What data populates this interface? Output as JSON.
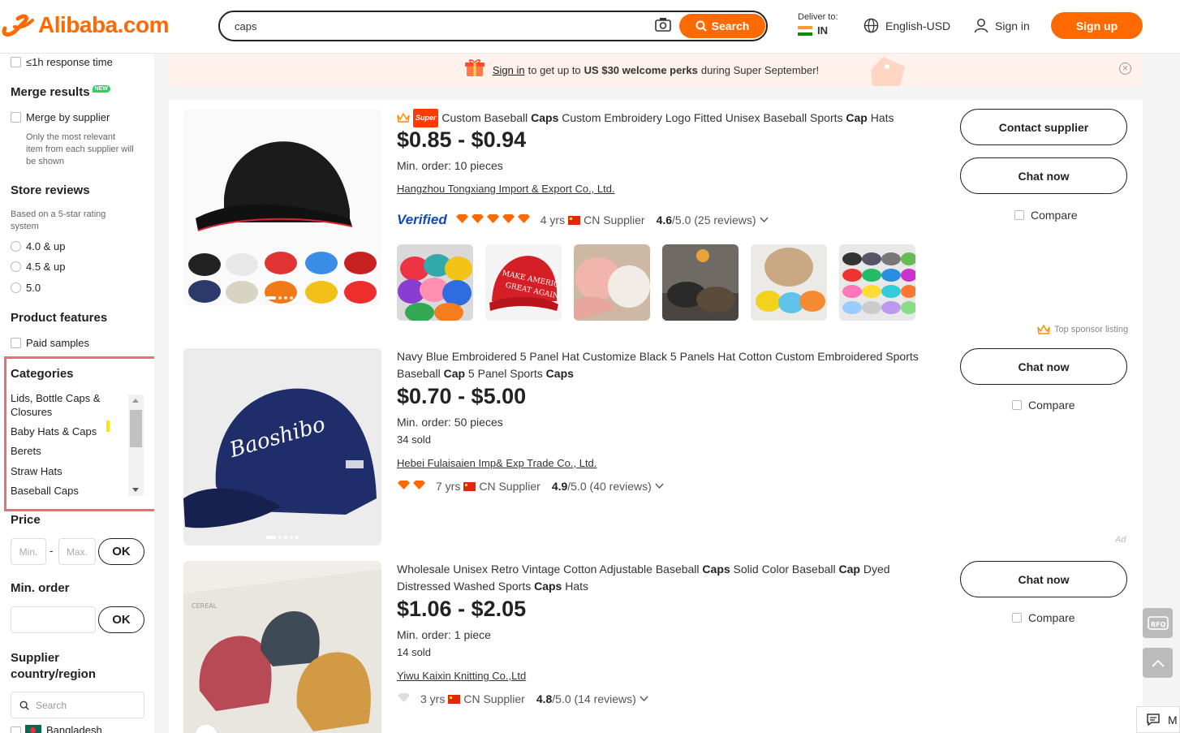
{
  "header": {
    "logo_text": "Alibaba.com",
    "search_value": "caps",
    "search_button": "Search",
    "deliver_label": "Deliver to:",
    "deliver_country": "IN",
    "language": "English-USD",
    "sign_in": "Sign in",
    "sign_up": "Sign up"
  },
  "sidebar": {
    "response_time": "≤1h response time",
    "merge_title": "Merge results",
    "merge_badge": "NEW",
    "merge_option": "Merge by supplier",
    "merge_note_1": "Only the most relevant",
    "merge_note_2": "item from each supplier will",
    "merge_note_3": "be shown",
    "store_reviews_title": "Store reviews",
    "store_reviews_note_1": "Based on a 5-star rating",
    "store_reviews_note_2": "system",
    "ratings": [
      "4.0 & up",
      "4.5 & up",
      "5.0"
    ],
    "features_title": "Product features",
    "paid_samples": "Paid samples",
    "categories_title": "Categories",
    "categories": [
      "Lids, Bottle Caps & Closures",
      "Baby Hats & Caps",
      "Berets",
      "Straw Hats",
      "Baseball Caps"
    ],
    "price_title": "Price",
    "price_min_placeholder": "Min.",
    "price_max_placeholder": "Max.",
    "price_dash": "-",
    "ok": "OK",
    "min_order_title": "Min. order",
    "supplier_country_title_1": "Supplier",
    "supplier_country_title_2": "country/region",
    "country_search_placeholder": "Search",
    "country_first": "Bangladesh"
  },
  "banner": {
    "sign_in_link": "Sign in",
    "text_1": "to get up to",
    "highlight": "US $30 welcome perks",
    "text_2": "during Super September!"
  },
  "products": [
    {
      "badge": "Super",
      "title_parts": [
        {
          "t": "Custom Baseball ",
          "b": false
        },
        {
          "t": "Caps",
          "b": true
        },
        {
          "t": " Custom Embroidery Logo Fitted Unisex Baseball Sports ",
          "b": false
        },
        {
          "t": "Cap",
          "b": true
        },
        {
          "t": " Hats",
          "b": false
        }
      ],
      "price": "$0.85 - $0.94",
      "min_order": "Min. order: 10 pieces",
      "supplier": "Hangzhou Tongxiang Import & Export Co., Ltd.",
      "verified": "Verified",
      "years": "4 yrs",
      "country": "CN Supplier",
      "rating_score": "4.6",
      "rating_rest": "/5.0 (25 reviews)",
      "diamonds": 5,
      "buttons": [
        "Contact supplier",
        "Chat now"
      ],
      "compare": "Compare",
      "sponsor": "Top sponsor listing"
    },
    {
      "title_parts": [
        {
          "t": "Navy Blue Embroidered 5 Panel Hat Customize Black 5 Panels Hat Cotton Custom Embroidered Sports Baseball ",
          "b": false
        },
        {
          "t": "Cap",
          "b": true
        },
        {
          "t": " 5 Panel Sports ",
          "b": false
        },
        {
          "t": "Caps",
          "b": true
        }
      ],
      "price": "$0.70 - $5.00",
      "min_order": "Min. order: 50 pieces",
      "sold": "34 sold",
      "supplier": "Hebei Fulaisaien Imp& Exp Trade Co., Ltd.",
      "years": "7 yrs",
      "country": "CN Supplier",
      "rating_score": "4.9",
      "rating_rest": "/5.0 (40 reviews)",
      "diamonds": 2,
      "buttons": [
        "Chat now"
      ],
      "compare": "Compare",
      "ad": "Ad"
    },
    {
      "title_parts": [
        {
          "t": "Wholesale Unisex Retro Vintage Cotton Adjustable Baseball ",
          "b": false
        },
        {
          "t": "Caps",
          "b": true
        },
        {
          "t": " Solid Color Baseball ",
          "b": false
        },
        {
          "t": "Cap",
          "b": true
        },
        {
          "t": " Dyed Distressed Washed Sports ",
          "b": false
        },
        {
          "t": "Caps",
          "b": true
        },
        {
          "t": " Hats",
          "b": false
        }
      ],
      "price": "$1.06 - $2.05",
      "min_order": "Min. order: 1 piece",
      "sold": "14 sold",
      "supplier": "Yiwu Kaixin Knitting Co.,Ltd",
      "years": "3 yrs",
      "country": "CN Supplier",
      "rating_score": "4.8",
      "rating_rest": "/5.0 (14 reviews)",
      "diamonds": 1,
      "buttons": [
        "Chat now"
      ],
      "compare": "Compare"
    }
  ],
  "float": {
    "rfq": "RFQ",
    "msg": "M"
  },
  "colors": {
    "brand": "#ff6a00",
    "highlight_box": "#e67178",
    "verified": "#0f49c1"
  }
}
